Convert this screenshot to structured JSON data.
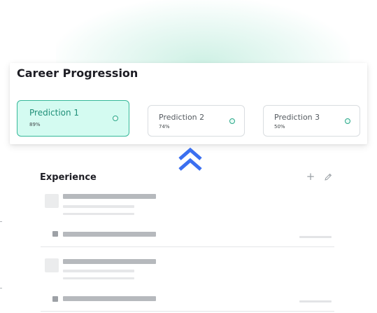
{
  "career": {
    "title": "Career Progression",
    "predictions": [
      {
        "name": "Prediction 1",
        "percent": "89%",
        "selected": true
      },
      {
        "name": "Prediction 2",
        "percent": "74%",
        "selected": false
      },
      {
        "name": "Prediction 3",
        "percent": "50%",
        "selected": false
      }
    ]
  },
  "expand_icon": "double-chevron-up-icon",
  "experience": {
    "title": "Experience",
    "add_icon": "plus-icon",
    "edit_icon": "pencil-icon"
  },
  "colors": {
    "accent_mint": "#d4fbf1",
    "accent_teal": "#37b89a",
    "chevron_blue": "#3b6ff0"
  }
}
